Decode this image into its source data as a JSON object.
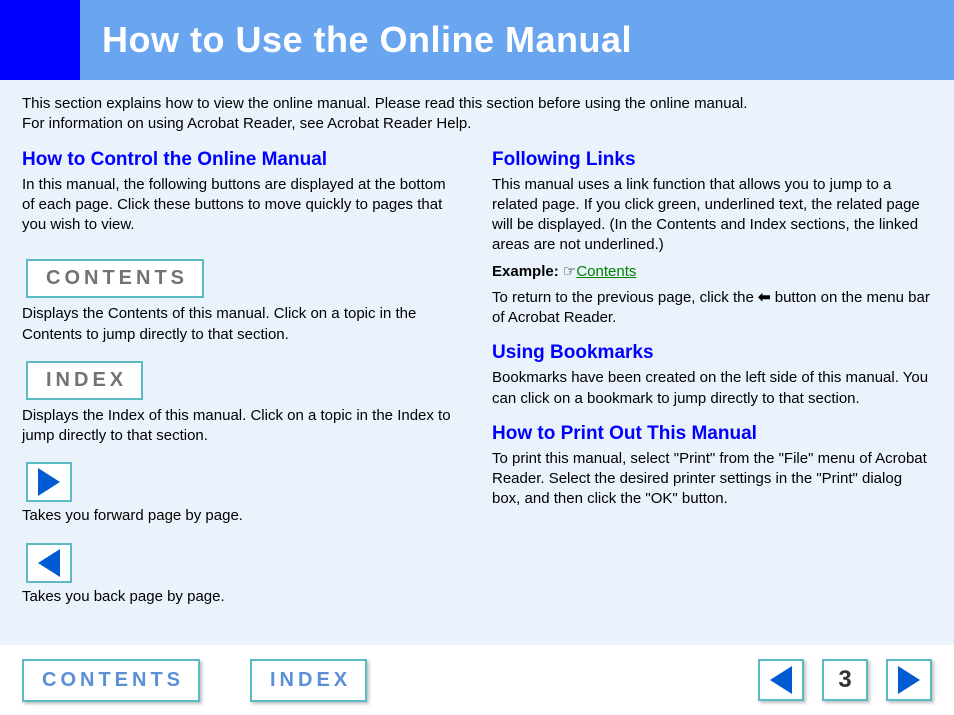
{
  "header": {
    "title": "How to Use the Online Manual"
  },
  "intro": {
    "line1": "This section explains how to view the online manual. Please read this section before using the online manual.",
    "line2": "For information on using Acrobat Reader, see Acrobat Reader Help."
  },
  "left": {
    "control": {
      "heading": "How to Control the Online Manual",
      "body": "In this manual, the following buttons are displayed at the bottom of each page. Click these buttons to move quickly to pages that you wish to view."
    },
    "contents_btn": "CONTENTS",
    "contents_desc": "Displays the Contents of this manual. Click on a topic in the Contents to jump directly to that section.",
    "index_btn": "INDEX",
    "index_desc": "Displays the Index of this manual. Click on a topic in the Index to jump directly to that section.",
    "forward_desc": "Takes you forward page by page.",
    "back_desc": "Takes you back page by page."
  },
  "right": {
    "links": {
      "heading": "Following Links",
      "body": "This manual uses a link function that allows you to jump to a related page. If you click green, underlined text, the related page will be displayed. (In the Contents and Index sections, the linked areas are not underlined.)",
      "example_label": "Example:",
      "example_hand": "☞",
      "example_link": "Contents",
      "return_pre": "To return to the previous page, click the ",
      "return_arrow": "⬅",
      "return_post": " button on the menu bar of Acrobat Reader."
    },
    "bookmarks": {
      "heading": "Using Bookmarks",
      "body": "Bookmarks have been created on the left side of this manual. You can click on a bookmark to jump directly to that section."
    },
    "print": {
      "heading": "How to Print Out This Manual",
      "body": "To print this manual, select \"Print\" from the \"File\" menu of Acrobat Reader. Select the desired printer settings in the \"Print\" dialog box, and then click the \"OK\" button."
    }
  },
  "footer": {
    "contents": "CONTENTS",
    "index": "INDEX",
    "page": "3"
  }
}
